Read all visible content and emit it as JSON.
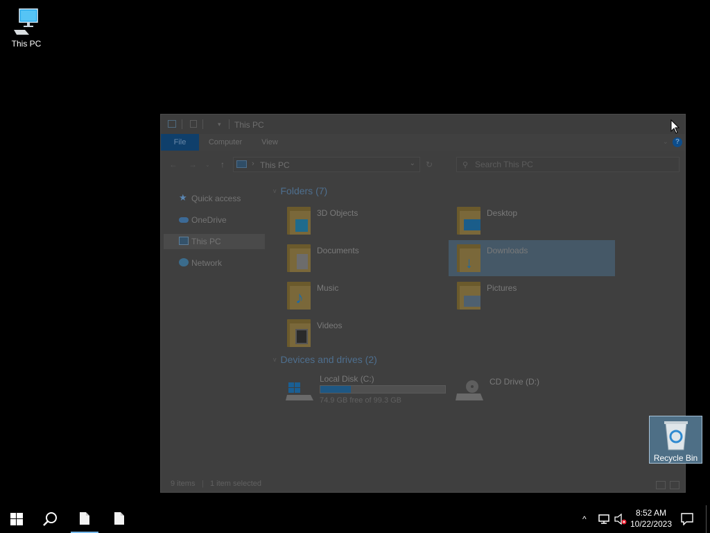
{
  "desktop": {
    "icons": [
      {
        "label": "This PC",
        "icon": "this-pc-icon"
      },
      {
        "label": "Recycle Bin",
        "icon": "recycle-bin-icon"
      }
    ]
  },
  "window": {
    "title": "This PC",
    "ribbon_tabs": [
      "File",
      "Computer",
      "View"
    ],
    "help_label": "?",
    "address": {
      "path": "This PC",
      "back_icon": "back-arrow-icon",
      "forward_icon": "forward-arrow-icon",
      "up_icon": "up-arrow-icon",
      "refresh_icon": "refresh-icon"
    },
    "search": {
      "placeholder": "Search This PC"
    },
    "nav_pane": [
      {
        "label": "Quick access",
        "icon": "star-icon"
      },
      {
        "label": "OneDrive",
        "icon": "cloud-icon"
      },
      {
        "label": "This PC",
        "icon": "computer-icon",
        "selected": true
      },
      {
        "label": "Network",
        "icon": "network-icon"
      }
    ],
    "folders_header": "Folders (7)",
    "folders": [
      {
        "name": "3D Objects",
        "icon": "3d-objects-folder-icon"
      },
      {
        "name": "Desktop",
        "icon": "desktop-folder-icon"
      },
      {
        "name": "Documents",
        "icon": "documents-folder-icon"
      },
      {
        "name": "Downloads",
        "icon": "downloads-folder-icon",
        "selected": true
      },
      {
        "name": "Music",
        "icon": "music-folder-icon"
      },
      {
        "name": "Pictures",
        "icon": "pictures-folder-icon"
      },
      {
        "name": "Videos",
        "icon": "videos-folder-icon"
      }
    ],
    "drives_header": "Devices and drives (2)",
    "drives": [
      {
        "name": "Local Disk (C:)",
        "free_text": "74.9 GB free of 99.3 GB",
        "used_fraction": 0.246,
        "icon": "hard-drive-icon"
      },
      {
        "name": "CD Drive (D:)",
        "icon": "cd-drive-icon"
      }
    ],
    "status": {
      "items": "9 items",
      "selected": "1 item selected"
    }
  },
  "taskbar": {
    "start_icon": "windows-start-icon",
    "search_icon": "search-icon",
    "apps": [
      {
        "icon": "document-icon",
        "active": true
      },
      {
        "icon": "document-icon",
        "active": false
      }
    ],
    "tray": {
      "chevron": "^",
      "time": "8:52 AM",
      "date": "10/22/2023"
    }
  },
  "colors": {
    "accent": "#0078d7",
    "selection": "#cce8ff",
    "desktop_bg": "#000000"
  }
}
